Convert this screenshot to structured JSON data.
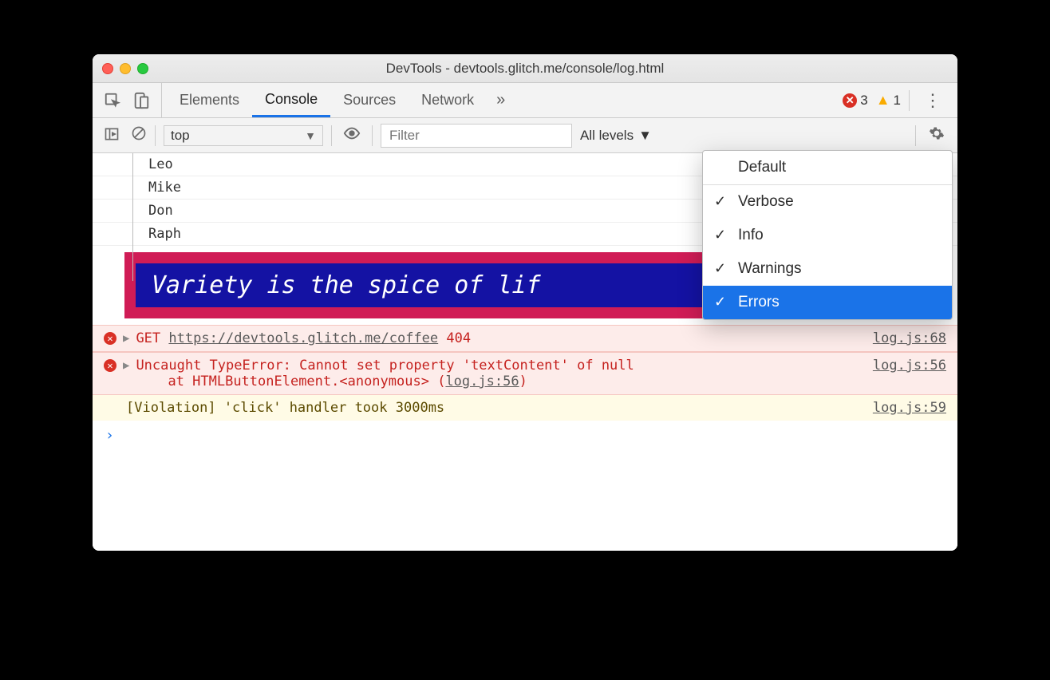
{
  "window": {
    "title": "DevTools - devtools.glitch.me/console/log.html"
  },
  "tabs": {
    "items": [
      "Elements",
      "Console",
      "Sources",
      "Network"
    ],
    "activeIndex": 1,
    "overflowGlyph": "»"
  },
  "badges": {
    "errorCount": "3",
    "warnCount": "1"
  },
  "toolbar": {
    "context": "top",
    "filterPlaceholder": "Filter",
    "levelsLabel": "All levels"
  },
  "logs": {
    "names": [
      "Leo",
      "Mike",
      "Don",
      "Raph"
    ],
    "styledMessage": "Variety is the spice of lif"
  },
  "errors": {
    "get": {
      "method": "GET",
      "url": "https://devtools.glitch.me/coffee",
      "status": "404",
      "source": "log.js:68"
    },
    "uncaught": {
      "line1": "Uncaught TypeError: Cannot set property 'textContent' of null",
      "line2pre": "at HTMLButtonElement.<anonymous> (",
      "line2link": "log.js:56",
      "line2post": ")",
      "source": "log.js:56"
    }
  },
  "violation": {
    "text": "[Violation] 'click' handler took 3000ms",
    "source": "log.js:59"
  },
  "dropdown": {
    "header": "Default",
    "items": [
      {
        "label": "Verbose",
        "checked": true,
        "selected": false
      },
      {
        "label": "Info",
        "checked": true,
        "selected": false
      },
      {
        "label": "Warnings",
        "checked": true,
        "selected": false
      },
      {
        "label": "Errors",
        "checked": true,
        "selected": true
      }
    ]
  },
  "prompt": "›"
}
